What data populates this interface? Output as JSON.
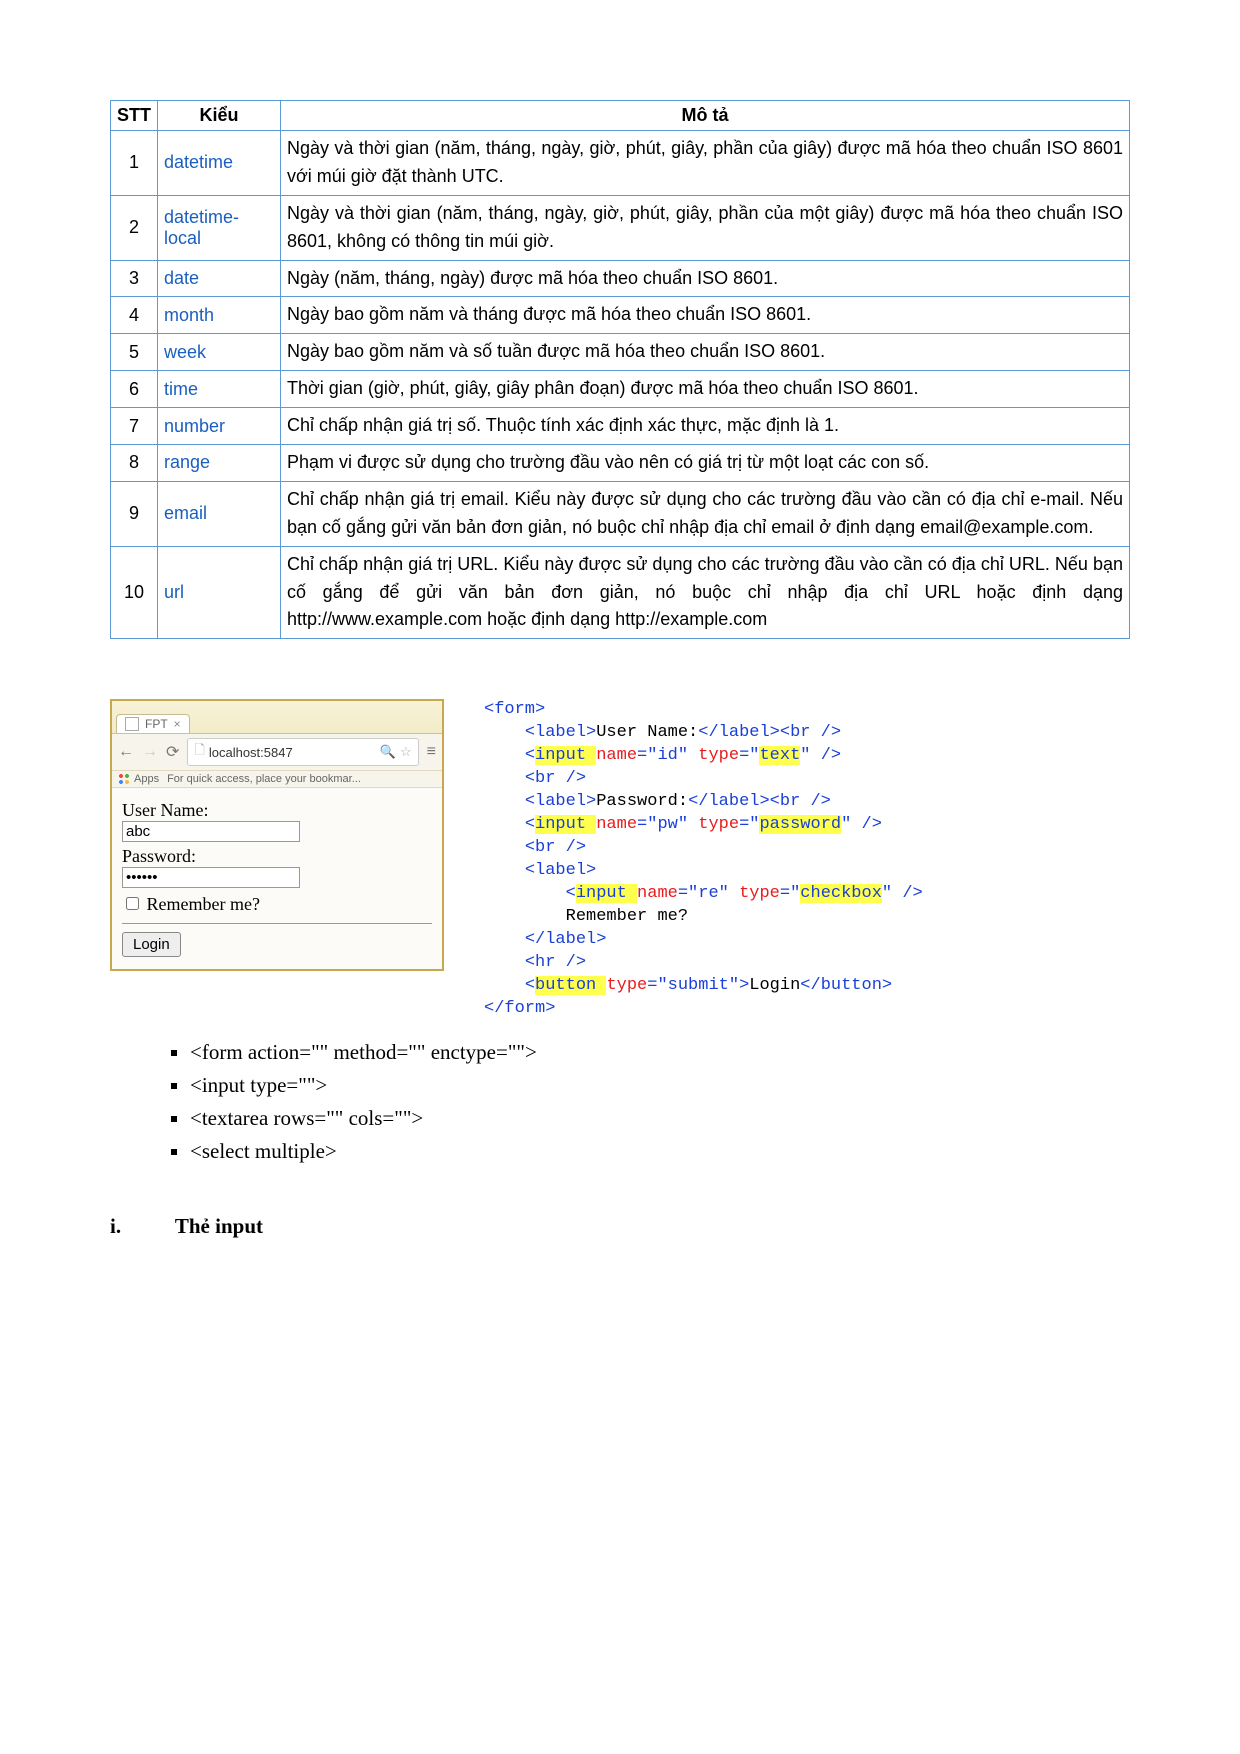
{
  "table": {
    "headers": {
      "stt": "STT",
      "type": "Kiểu",
      "desc": "Mô tả"
    },
    "rows": [
      {
        "n": "1",
        "type": "datetime",
        "desc": "Ngày và thời gian (năm, tháng, ngày, giờ, phút, giây, phần của giây) được mã hóa theo chuẩn ISO 8601 với múi giờ đặt thành UTC."
      },
      {
        "n": "2",
        "type": "datetime-local",
        "desc": "Ngày và thời gian (năm, tháng, ngày, giờ, phút, giây, phần của một giây) được mã hóa theo  chuẩn ISO 8601, không có thông tin múi giờ."
      },
      {
        "n": "3",
        "type": "date",
        "desc": "Ngày (năm, tháng, ngày) được mã hóa theo  chuẩn ISO 8601."
      },
      {
        "n": "4",
        "type": "month",
        "desc": "Ngày bao gồm năm và tháng được mã hóa theo chuẩn ISO 8601."
      },
      {
        "n": "5",
        "type": "week",
        "desc": "Ngày bao gồm năm và số tuần được mã hóa theo chuẩn ISO 8601."
      },
      {
        "n": "6",
        "type": "time",
        "desc": "Thời gian (giờ, phút, giây, giây phân đoạn) được mã hóa theo chuẩn ISO 8601."
      },
      {
        "n": "7",
        "type": "number",
        "desc": "Chỉ chấp nhận giá trị số. Thuộc tính xác định xác thực, mặc định là 1."
      },
      {
        "n": "8",
        "type": "range",
        "desc": "Phạm vi được sử dụng cho trường đầu vào nên có giá trị từ một loạt các con số."
      },
      {
        "n": "9",
        "type": "email",
        "desc": "Chỉ chấp nhận giá trị email. Kiểu này được sử dụng cho các trường đầu vào cần có địa chỉ e-mail. Nếu bạn cố gắng gửi văn bản đơn giản, nó buộc chỉ nhập địa chỉ email ở định dạng email@example.com."
      },
      {
        "n": "10",
        "type": "url",
        "desc": "Chỉ chấp nhận giá trị URL. Kiểu này được sử dụng cho các trường đầu vào cần có địa chỉ URL. Nếu bạn cố gắng để gửi văn bản đơn giản, nó buộc chỉ nhập địa chỉ URL hoặc định dạng http://www.example.com hoặc định dạng http://example.com"
      }
    ]
  },
  "browser": {
    "tab_title": "FPT",
    "url": "localhost:5847",
    "apps_label": "Apps",
    "apps_hint": "For quick access, place your bookmar...",
    "label_user": "User Name:",
    "value_user": "abc",
    "label_pw": "Password:",
    "value_pw": "••••••",
    "remember": "Remember me?",
    "login": "Login"
  },
  "code": {
    "l1a": "<form>",
    "l2_label": "<label>",
    "l2_txt": "User Name:",
    "l2_close": "</label><br />",
    "l3_open": "<",
    "l3_input": "input ",
    "l3_name": "name",
    "l3_eq1": "=\"id\" ",
    "l3_type": "type",
    "l3_eq2": "=\"",
    "l3_val": "text",
    "l3_close": "\" />",
    "l4": "<br />",
    "l5_label": "<label>",
    "l5_txt": "Password:",
    "l5_close": "</label><br />",
    "l6_open": "<",
    "l6_input": "input ",
    "l6_name": "name",
    "l6_eq1": "=\"pw\" ",
    "l6_type": "type",
    "l6_eq2": "=\"",
    "l6_val": "password",
    "l6_close": "\" />",
    "l7": "<br />",
    "l8": "<label>",
    "l9_open": "<",
    "l9_input": "input ",
    "l9_name": "name",
    "l9_eq1": "=\"re\" ",
    "l9_type": "type",
    "l9_eq2": "=\"",
    "l9_val": "checkbox",
    "l9_close": "\" />",
    "l10": "Remember me?",
    "l11": "</label>",
    "l12": "<hr />",
    "l13_open": "<",
    "l13_button": "button ",
    "l13_type": "type",
    "l13_eq": "=\"submit\">",
    "l13_txt": "Login",
    "l13_close": "</button>",
    "l14": "</form>"
  },
  "bullets": {
    "b1": "<form action=\"\" method=\"\" enctype=\"\">",
    "b2": "<input type=\"\">",
    "b3": "<textarea rows=\"\" cols=\"\">",
    "b4": "<select multiple>"
  },
  "heading": {
    "num": "i.",
    "text": "Thẻ input"
  }
}
